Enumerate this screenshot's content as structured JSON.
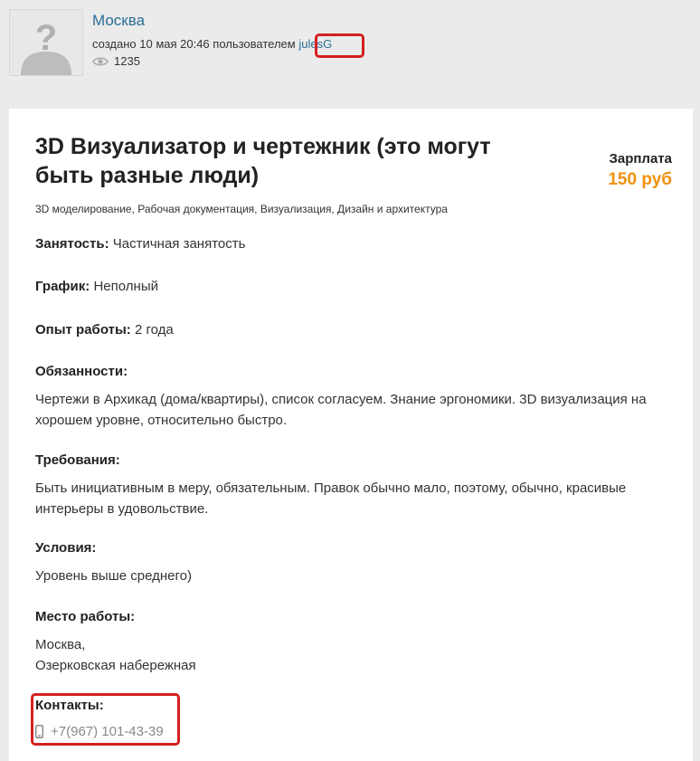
{
  "header": {
    "city": "Москва",
    "created_prefix": "создано 10 мая 20:46 пользователем ",
    "username": "julesG",
    "views": "1235"
  },
  "job": {
    "title": "3D Визуализатор и чертежник (это могут быть разные люди)",
    "salary_label": "Зарплата",
    "salary_value": "150 руб",
    "tags": "3D моделирование, Рабочая документация, Визуализация, Дизайн и архитектура",
    "employment_label": "Занятость:",
    "employment_value": "Частичная занятость",
    "schedule_label": "График:",
    "schedule_value": "Неполный",
    "experience_label": "Опыт работы:",
    "experience_value": "2 года",
    "duties_label": "Обязанности:",
    "duties_text": "Чертежи в Архикад (дома/квартиры), список согласуем. Знание эргономики. 3D визуализация на хорошем уровне, относительно быстро.",
    "requirements_label": "Требования:",
    "requirements_text": "Быть инициативным в меру, обязательным. Правок обычно мало, поэтому, обычно, красивые интерьеры в удовольствие.",
    "conditions_label": "Условия:",
    "conditions_text": "Уровень выше среднего)",
    "workplace_label": "Место работы:",
    "workplace_line1": "Москва,",
    "workplace_line2": "Озерковская набережная",
    "contacts_label": "Контакты:",
    "phone": "+7(967) 101-43-39"
  },
  "colors": {
    "link": "#2a6f97",
    "salary": "#f0900e",
    "highlight": "#d42020"
  },
  "icons": [
    "avatar-placeholder-icon",
    "eye-icon",
    "phone-icon"
  ]
}
